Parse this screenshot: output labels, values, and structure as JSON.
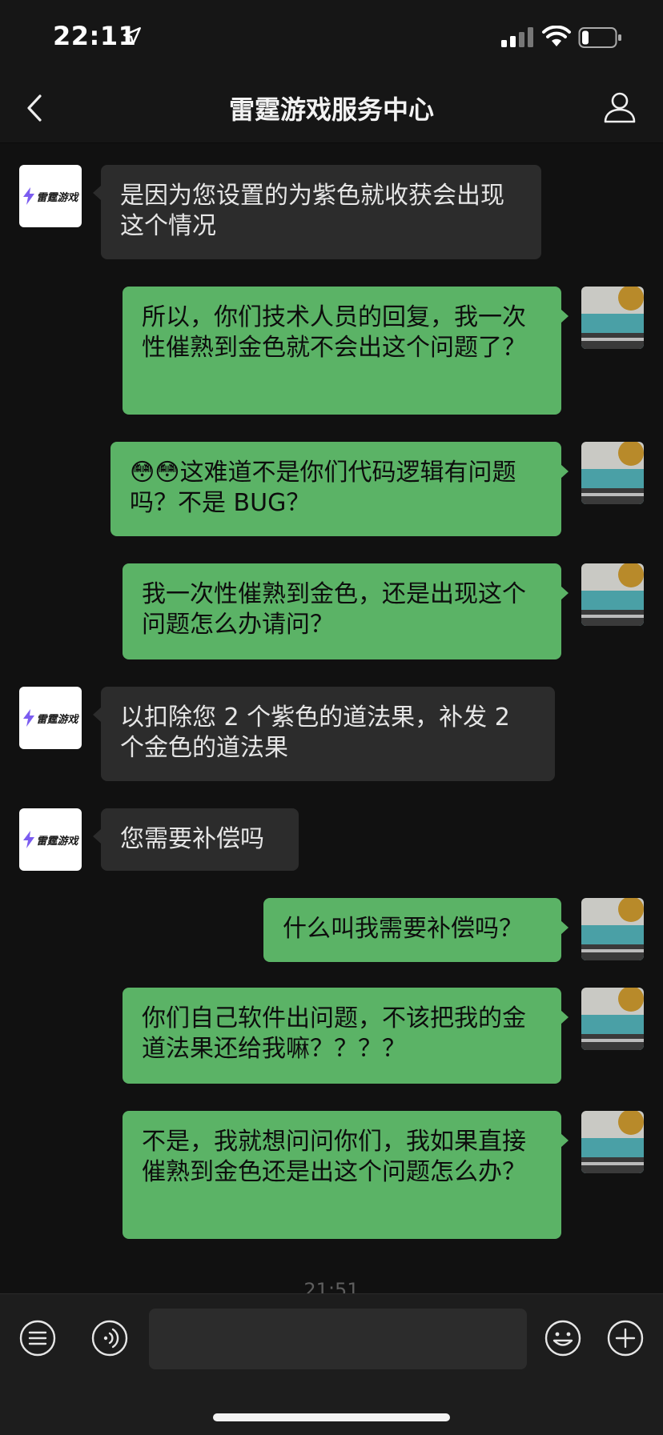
{
  "status_bar": {
    "time": "22:11"
  },
  "nav": {
    "title": "雷霆游戏服务中心"
  },
  "service_avatar": {
    "logo_text": "雷霆游戏"
  },
  "messages": [
    {
      "from": "service",
      "text": "是因为您设置的为紫色就收获会出现这个情况"
    },
    {
      "from": "user",
      "text": "所以，你们技术人员的回复，我一次性催熟到金色就不会出这个问题了？"
    },
    {
      "from": "user",
      "text": "这难道不是你们代码逻辑有问题吗？不是 BUG？",
      "emoji": [
        "😳",
        "😳"
      ]
    },
    {
      "from": "user",
      "text": "我一次性催熟到金色，还是出现这个问题怎么办请问？"
    },
    {
      "from": "service",
      "text": "以扣除您 2 个紫色的道法果，补发 2 个金色的道法果"
    },
    {
      "from": "service",
      "text": "您需要补偿吗"
    },
    {
      "from": "user",
      "text": "什么叫我需要补偿吗？"
    },
    {
      "from": "user",
      "text": "你们自己软件出问题，不该把我的金道法果还给我嘛？？？？"
    },
    {
      "from": "user",
      "text": "不是，我就想问问你们，我如果直接催熟到金色还是出这个问题怎么办？"
    }
  ],
  "timestamp": "21:51",
  "input": {
    "value": "",
    "placeholder": ""
  },
  "colors": {
    "background": "#111111",
    "bubble_in": "#2c2c2c",
    "bubble_out": "#5bb366"
  },
  "icons": {
    "status": [
      "location-arrow-icon",
      "signal-icon",
      "wifi-icon",
      "battery-icon"
    ],
    "nav": [
      "back-chevron-icon",
      "profile-icon"
    ],
    "input_bar": [
      "menu-list-icon",
      "voice-icon",
      "emoji-icon",
      "plus-icon"
    ]
  }
}
